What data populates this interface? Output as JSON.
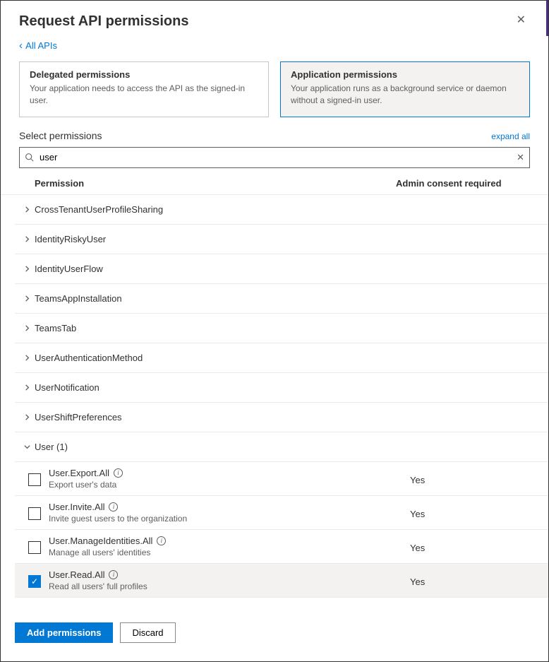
{
  "header": {
    "title": "Request API permissions"
  },
  "back_link": "All APIs",
  "perm_types": {
    "delegated": {
      "title": "Delegated permissions",
      "desc": "Your application needs to access the API as the signed-in user."
    },
    "application": {
      "title": "Application permissions",
      "desc": "Your application runs as a background service or daemon without a signed-in user."
    }
  },
  "select_label": "Select permissions",
  "expand_all": "expand all",
  "search": {
    "value": "user"
  },
  "columns": {
    "permission": "Permission",
    "admin": "Admin consent required"
  },
  "groups": [
    {
      "label": "CrossTenantUserProfileSharing",
      "expanded": false
    },
    {
      "label": "IdentityRiskyUser",
      "expanded": false
    },
    {
      "label": "IdentityUserFlow",
      "expanded": false
    },
    {
      "label": "TeamsAppInstallation",
      "expanded": false
    },
    {
      "label": "TeamsTab",
      "expanded": false
    },
    {
      "label": "UserAuthenticationMethod",
      "expanded": false
    },
    {
      "label": "UserNotification",
      "expanded": false
    },
    {
      "label": "UserShiftPreferences",
      "expanded": false
    },
    {
      "label": "User (1)",
      "expanded": true
    }
  ],
  "permissions": [
    {
      "name": "User.Export.All",
      "desc": "Export user's data",
      "admin": "Yes",
      "checked": false,
      "selected": false
    },
    {
      "name": "User.Invite.All",
      "desc": "Invite guest users to the organization",
      "admin": "Yes",
      "checked": false,
      "selected": false
    },
    {
      "name": "User.ManageIdentities.All",
      "desc": "Manage all users' identities",
      "admin": "Yes",
      "checked": false,
      "selected": false
    },
    {
      "name": "User.Read.All",
      "desc": "Read all users' full profiles",
      "admin": "Yes",
      "checked": true,
      "selected": true
    }
  ],
  "footer": {
    "add": "Add permissions",
    "discard": "Discard"
  }
}
